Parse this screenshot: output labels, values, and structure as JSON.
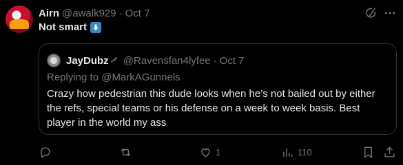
{
  "tweet": {
    "author_name": "Airn",
    "handle": "@awalk929",
    "separator": "·",
    "date": "Oct 7",
    "text": "Not smart",
    "emoji": "down-arrow-emoji"
  },
  "quote": {
    "author_name": "JayDubz",
    "raven_glyph": "🐦‍⬛",
    "handle": "@Ravensfan4lyfee",
    "separator": "·",
    "date": "Oct 7",
    "replying_prefix": "Replying to",
    "replying_mention": "@MarkAGunnels",
    "body_lines": [
      "Crazy how pedestrian this dude looks when he’s not bailed out by either",
      "the refs, special teams or his defense on a week to week basis. Best",
      "player in the world my ass"
    ]
  },
  "actions": {
    "reply_count": "",
    "retweet_count": "",
    "like_count": "1",
    "views_count": "110"
  },
  "colors": {
    "background": "#000000",
    "text_primary": "#e7e9ea",
    "text_secondary": "#71767b",
    "border": "#2f3336",
    "emoji_blue": "#3b88c3"
  }
}
